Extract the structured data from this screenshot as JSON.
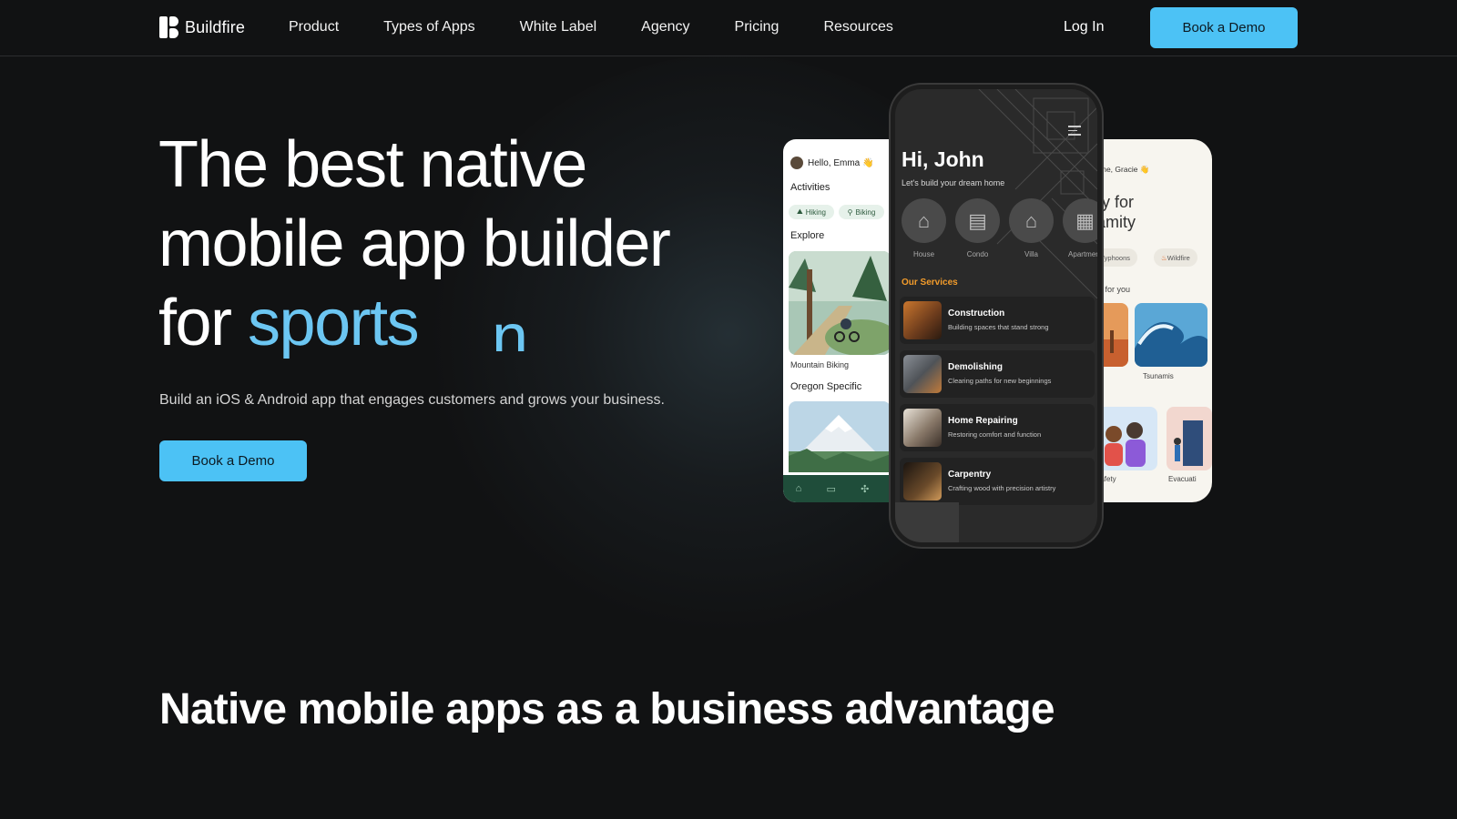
{
  "nav": {
    "brand": "Buildfire",
    "links": [
      "Product",
      "Types of Apps",
      "White Label",
      "Agency",
      "Pricing",
      "Resources"
    ],
    "login": "Log In",
    "cta": "Book a Demo"
  },
  "hero": {
    "title_line1": "The best native",
    "title_line2": "mobile app builder",
    "title_prefix": "for ",
    "title_accent": "sports",
    "title_ghost": "n",
    "subtitle": "Build an iOS & Android app that engages customers and grows your business.",
    "cta": "Book a Demo"
  },
  "section": {
    "title": "Native mobile apps as a business advantage"
  },
  "phone_left": {
    "greeting": "Hello, Emma 👋",
    "activities": "Activities",
    "chips": [
      "Hiking",
      "Biking"
    ],
    "explore": "Explore",
    "card1_caption": "Mountain Biking",
    "card2_title": "Oregon Specific"
  },
  "phone_center": {
    "greeting": "Hi, John",
    "subtitle": "Let's build your dream home",
    "categories": [
      "House",
      "Condo",
      "Villa",
      "Apartment"
    ],
    "services_title": "Our Services",
    "services": [
      {
        "title": "Construction",
        "desc": "Building spaces that stand strong"
      },
      {
        "title": "Demolishing",
        "desc": "Clearing paths for new beginnings"
      },
      {
        "title": "Home Repairing",
        "desc": "Restoring comfort and function"
      },
      {
        "title": "Carpentry",
        "desc": "Crafting wood with precision artistry"
      }
    ]
  },
  "phone_right": {
    "greeting": "lcome, Gracie 👋",
    "head_line1": "dy for",
    "head_line2": "lamity",
    "chips": [
      "Typhoons",
      "Wildfire"
    ],
    "section": "ed for you",
    "tiles": [
      "Tsunamis",
      "Safety",
      "Evacuati"
    ]
  },
  "colors": {
    "background": "#111213",
    "accent": "#6cc6f2",
    "cta": "#4cc2f5",
    "services_accent": "#f39c2b"
  }
}
